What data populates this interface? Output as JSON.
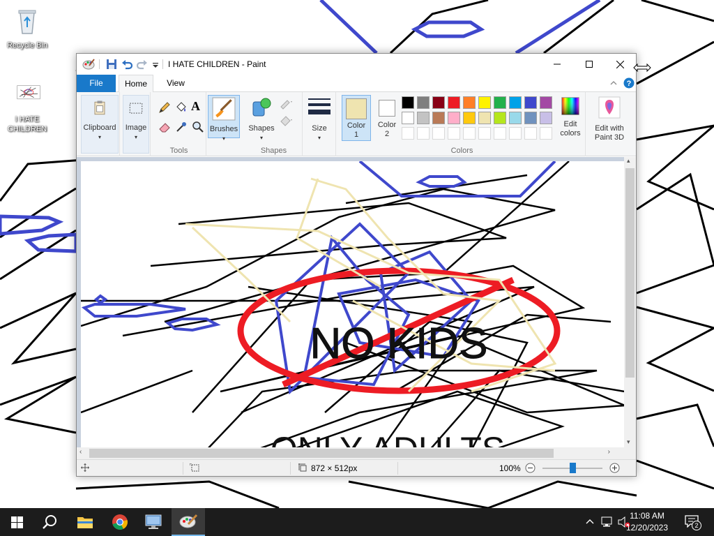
{
  "desktop": {
    "icons": [
      {
        "label": "Recycle Bin"
      },
      {
        "label": "I HATE CHILDREN"
      }
    ]
  },
  "window": {
    "title": "I HATE CHILDREN - Paint",
    "tabs": [
      {
        "label": "File"
      },
      {
        "label": "Home"
      },
      {
        "label": "View"
      }
    ],
    "ribbon": {
      "clipboard": {
        "label": "Clipboard"
      },
      "image": {
        "label": "Image"
      },
      "tools_group": "Tools",
      "brushes": {
        "label": "Brushes"
      },
      "shapes": {
        "label": "Shapes"
      },
      "shapes_group": "Shapes",
      "size": {
        "label": "Size"
      },
      "color1": {
        "label_line1": "Color",
        "label_line2": "1"
      },
      "color2": {
        "label_line1": "Color",
        "label_line2": "2"
      },
      "colors_group": "Colors",
      "edit_colors": {
        "label_line1": "Edit",
        "label_line2": "colors"
      },
      "edit_paint3d": {
        "label_line1": "Edit with",
        "label_line2": "Paint 3D"
      }
    },
    "palette": {
      "row1": [
        "#000000",
        "#7f7f7f",
        "#880015",
        "#ed1c24",
        "#ff7f27",
        "#fff200",
        "#22b14c",
        "#00a2e8",
        "#3f48cc",
        "#a349a4"
      ],
      "row2": [
        "#ffffff",
        "#c3c3c3",
        "#b97a57",
        "#ffaec9",
        "#ffc90e",
        "#efe4b0",
        "#b5e61d",
        "#99d9ea",
        "#7092be",
        "#c8bfe7"
      ]
    },
    "colors": {
      "color1": "#efe4b0",
      "color2": "#ffffff",
      "accent": "#1979ca",
      "stroke_blue": "#3f48cc",
      "stroke_red": "#ed1c24",
      "stroke_yellow": "#efe4b0"
    },
    "canvas": {
      "text_top": "NO KIDS",
      "text_bottom": "ONLY ADULTS"
    },
    "status": {
      "dimensions": "872 × 512px",
      "zoom": "100%",
      "zoom_level": 0.5
    }
  },
  "taskbar": {
    "time": "11:08 AM",
    "date": "12/20/2023",
    "notifications": "2"
  }
}
